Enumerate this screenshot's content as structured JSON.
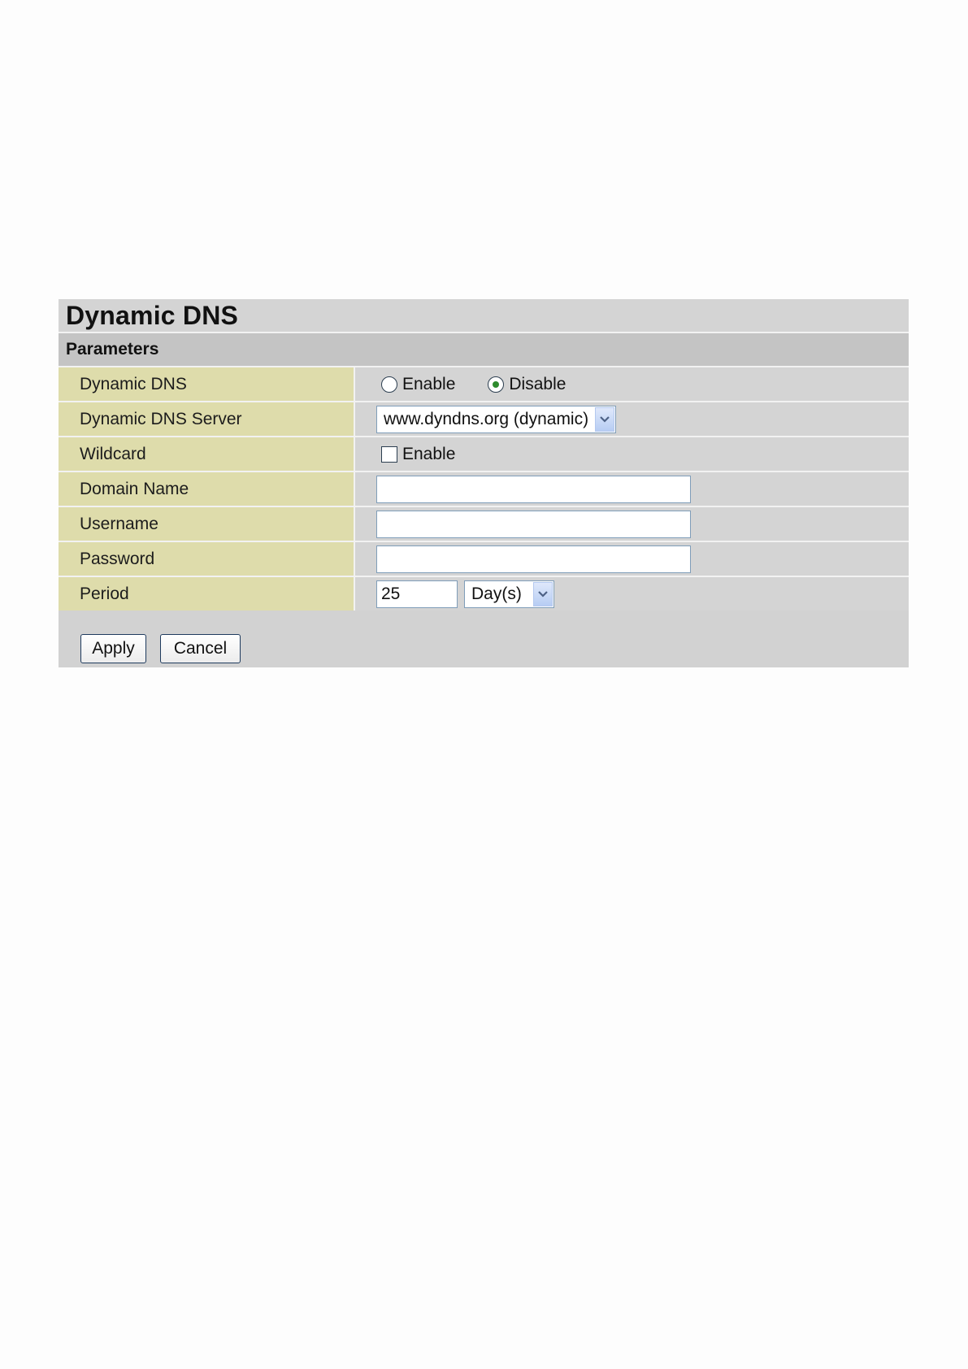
{
  "title": "Dynamic DNS",
  "section": "Parameters",
  "rows": {
    "dynamic_dns": {
      "label": "Dynamic DNS",
      "options": [
        "Enable",
        "Disable"
      ],
      "selected": "Disable"
    },
    "server": {
      "label": "Dynamic DNS Server",
      "value": "www.dyndns.org (dynamic)"
    },
    "wildcard": {
      "label": "Wildcard",
      "checkbox_label": "Enable",
      "checked": false
    },
    "domain_name": {
      "label": "Domain Name",
      "value": ""
    },
    "username": {
      "label": "Username",
      "value": ""
    },
    "password": {
      "label": "Password",
      "value": ""
    },
    "period": {
      "label": "Period",
      "value": "25",
      "unit": "Day(s)"
    }
  },
  "buttons": {
    "apply": "Apply",
    "cancel": "Cancel"
  },
  "icons": {
    "dropdown": "chevron-down-icon"
  },
  "colors": {
    "label_bg": "#dedcab",
    "value_bg": "#d4d4d4",
    "section_bg": "#c4c4c4",
    "radio_selected": "#2e8b2e"
  }
}
